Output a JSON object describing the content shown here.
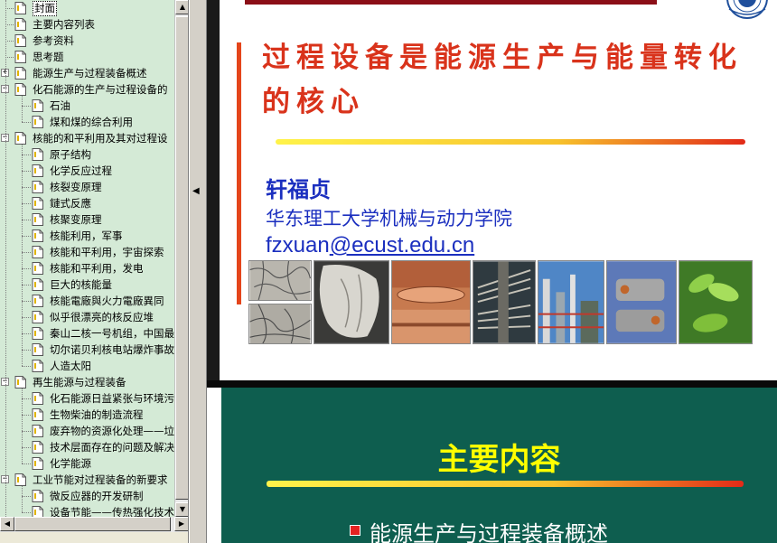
{
  "outline": {
    "items": [
      {
        "label": "封面",
        "level": 1,
        "selected": true
      },
      {
        "label": "主要内容列表",
        "level": 1
      },
      {
        "label": "参考资料",
        "level": 1
      },
      {
        "label": "思考题",
        "level": 1
      },
      {
        "label": "能源生产与过程装备概述",
        "level": 1,
        "toggle": "+"
      },
      {
        "label": "化石能源的生产与过程设备的",
        "level": 1,
        "toggle": "-"
      },
      {
        "label": "石油",
        "level": 2
      },
      {
        "label": "煤和煤的综合利用",
        "level": 2
      },
      {
        "label": "核能的和平利用及其对过程设",
        "level": 1,
        "toggle": "-"
      },
      {
        "label": "原子结构",
        "level": 2
      },
      {
        "label": "化学反应过程",
        "level": 2
      },
      {
        "label": "核裂变原理",
        "level": 2
      },
      {
        "label": "鏈式反應",
        "level": 2
      },
      {
        "label": "核聚变原理",
        "level": 2
      },
      {
        "label": "核能利用，军事",
        "level": 2
      },
      {
        "label": "核能和平利用，宇宙探索",
        "level": 2
      },
      {
        "label": "核能和平利用，发电",
        "level": 2
      },
      {
        "label": "巨大的核能量",
        "level": 2
      },
      {
        "label": "核能電廠與火力電廠異同",
        "level": 2
      },
      {
        "label": "似乎很漂亮的核反应堆",
        "level": 2
      },
      {
        "label": "秦山二核一号机组，中国最",
        "level": 2
      },
      {
        "label": "切尔诺贝利核电站爆炸事故",
        "level": 2
      },
      {
        "label": "人造太阳",
        "level": 2
      },
      {
        "label": "再生能源与过程装备",
        "level": 1,
        "toggle": "-"
      },
      {
        "label": "化石能源日益紧张与环境污",
        "level": 2
      },
      {
        "label": "生物柴油的制造流程",
        "level": 2
      },
      {
        "label": "废弃物的资源化处理——垃",
        "level": 2
      },
      {
        "label": "技术层面存在的问题及解决",
        "level": 2
      },
      {
        "label": "化学能源",
        "level": 2
      },
      {
        "label": "工业节能对过程装备的新要求",
        "level": 1,
        "toggle": "-"
      },
      {
        "label": "微反应器的开发研制",
        "level": 2
      },
      {
        "label": "设备节能——传热强化技术",
        "level": 2
      }
    ]
  },
  "slide1": {
    "title": "过程设备是能源生产与能量转化的核心",
    "author": "轩福贞",
    "affiliation": "华东理工大学机械与动力学院",
    "email_user": "fzxuan",
    "email_domain": "@ecust.edu.cn",
    "photos": [
      "cracked-surface",
      "fractured-metal",
      "corroded-weld",
      "turbine-blades",
      "refinery-plant",
      "heat-exchanger",
      "green-leaves"
    ]
  },
  "slide2": {
    "title": "主要内容",
    "first_item": "能源生产与过程装备概述"
  },
  "colors": {
    "outline_bg": "#d4ead6",
    "title_red": "#d9331b",
    "author_blue": "#1b2fbf",
    "slide2_bg": "#0e5e4f",
    "slide2_title": "#ffff00"
  }
}
